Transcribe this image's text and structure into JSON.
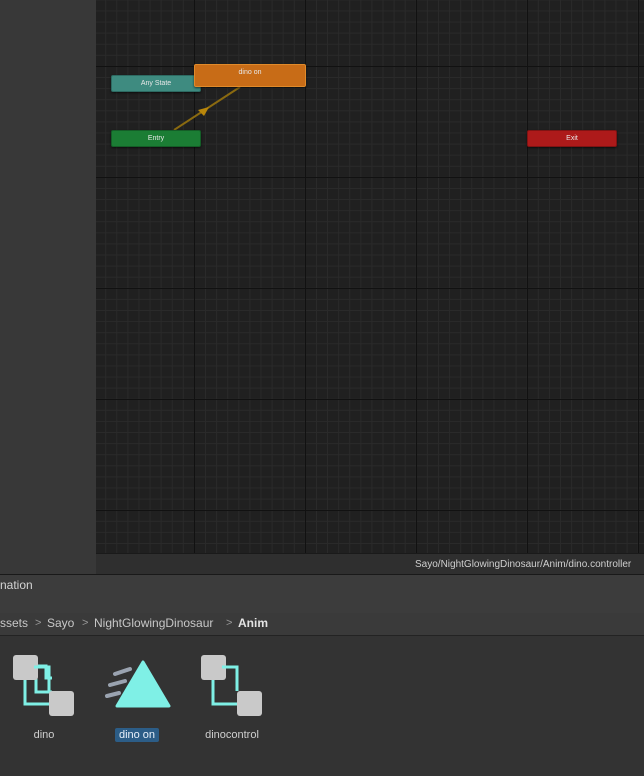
{
  "graph": {
    "nodes": {
      "any_state": "Any State",
      "entry": "Entry",
      "exit": "Exit",
      "dino_on": "dino on"
    },
    "path": "Sayo/NightGlowingDinosaur/Anim/dino.controller"
  },
  "project": {
    "panel_title": "nation",
    "breadcrumb": [
      "ssets",
      "Sayo",
      "NightGlowingDinosaur",
      "Anim"
    ],
    "breadcrumb_separator": ">",
    "assets": [
      {
        "label": "dino",
        "icon": "animator-controller-icon",
        "selected": false
      },
      {
        "label": "dino on",
        "icon": "animation-clip-icon",
        "selected": true
      },
      {
        "label": "dinocontrol",
        "icon": "animator-controller-icon",
        "selected": false
      }
    ]
  },
  "colors": {
    "any_state": "#3e8b80",
    "entry": "#1b7d34",
    "exit": "#ad1a1a",
    "default_state": "#c86c17",
    "transition": "#b8860b",
    "selection": "#2c5d87",
    "icon_accent": "#7ff0e6"
  }
}
